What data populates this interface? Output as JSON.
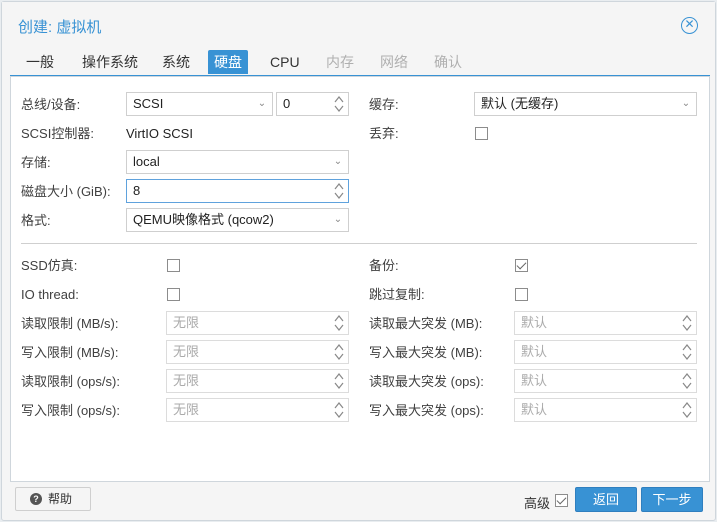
{
  "window": {
    "title": "创建: 虚拟机"
  },
  "tabs": [
    {
      "label": "一般",
      "state": "normal"
    },
    {
      "label": "操作系统",
      "state": "normal"
    },
    {
      "label": "系统",
      "state": "normal"
    },
    {
      "label": "硬盘",
      "state": "active"
    },
    {
      "label": "CPU",
      "state": "normal"
    },
    {
      "label": "内存",
      "state": "disabled"
    },
    {
      "label": "网络",
      "state": "disabled"
    },
    {
      "label": "确认",
      "state": "disabled"
    }
  ],
  "left": {
    "bus_label": "总线/设备:",
    "bus_value": "SCSI",
    "device_value": "0",
    "controller_label": "SCSI控制器:",
    "controller_value": "VirtIO SCSI",
    "storage_label": "存储:",
    "storage_value": "local",
    "size_label": "磁盘大小 (GiB):",
    "size_value": "8",
    "format_label": "格式:",
    "format_value": "QEMU映像格式 (qcow2)"
  },
  "right": {
    "cache_label": "缓存:",
    "cache_value": "默认 (无缓存)",
    "discard_label": "丢弃:",
    "discard_checked": false
  },
  "advanced": {
    "ssd_label": "SSD仿真:",
    "ssd_checked": false,
    "io_label": "IO thread:",
    "io_checked": false,
    "backup_label": "备份:",
    "backup_checked": true,
    "skip_replication_label": "跳过复制:",
    "skip_replication_checked": false,
    "read_mbs_label": "读取限制 (MB/s):",
    "write_mbs_label": "写入限制 (MB/s):",
    "read_ops_label": "读取限制 (ops/s):",
    "write_ops_label": "写入限制 (ops/s):",
    "unlimited_placeholder": "无限",
    "read_burst_mb_label": "读取最大突发 (MB):",
    "write_burst_mb_label": "写入最大突发 (MB):",
    "read_burst_ops_label": "读取最大突发 (ops):",
    "write_burst_ops_label": "写入最大突发 (ops):",
    "default_placeholder": "默认"
  },
  "footer": {
    "help_label": "帮助",
    "advanced_label": "高级",
    "advanced_checked": true,
    "back_label": "返回",
    "next_label": "下一步"
  },
  "colors": {
    "accent": "#3892d4"
  }
}
